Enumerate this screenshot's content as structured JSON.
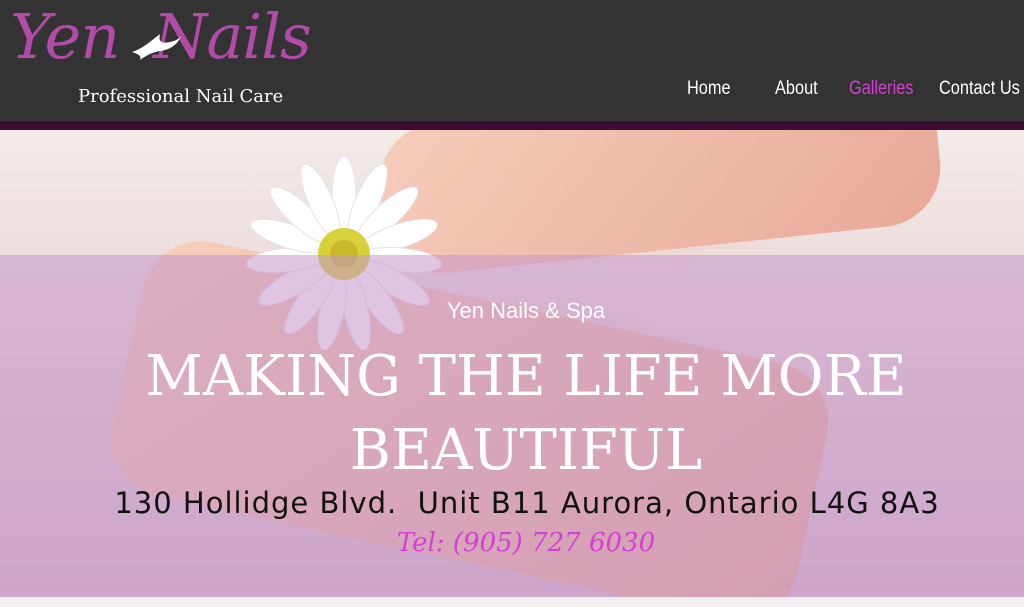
{
  "brand": {
    "logo_word1": "Yen",
    "logo_word2": "Nails",
    "tagline": "Professional Nail Care"
  },
  "nav": {
    "items": [
      {
        "label": "Home",
        "active": false
      },
      {
        "label": "About",
        "active": false
      },
      {
        "label": "Galleries",
        "active": true
      },
      {
        "label": "Contact Us",
        "active": false
      }
    ]
  },
  "hero": {
    "subtitle": "Yen Nails & Spa",
    "title_line1": "MAKING THE LIFE MORE",
    "title_line2": "BEAUTIFUL",
    "address": "130 Hollidge Blvd.  Unit B11 Aurora, Ontario L4G 8A3",
    "phone": "Tel: (905) 727 6030"
  },
  "colors": {
    "header_bg": "#333333",
    "accent": "#d63fd6",
    "logo": "#b24aa8",
    "divider": "#3d0c35"
  },
  "icons": {
    "logo_bird": "swallow-icon",
    "hero_flower": "daisy-icon"
  }
}
